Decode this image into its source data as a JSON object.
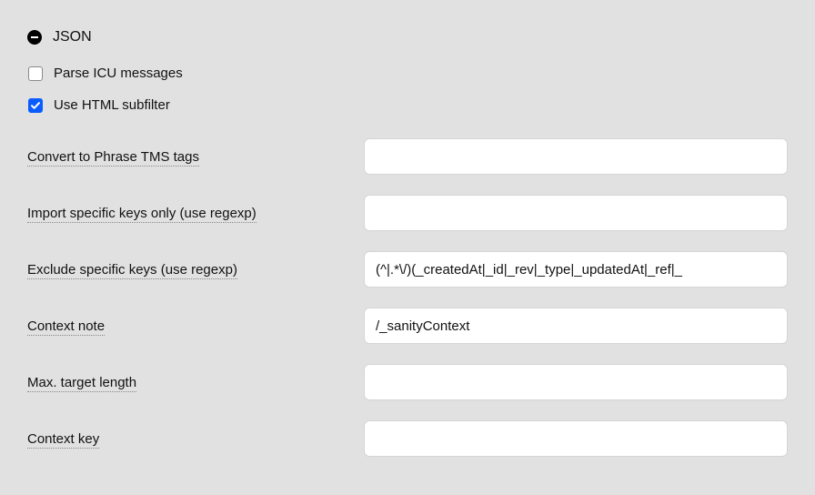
{
  "section": {
    "title": "JSON"
  },
  "checks": {
    "parse_icu": {
      "label": "Parse ICU messages",
      "checked": false
    },
    "html_subfilter": {
      "label": "Use HTML subfilter",
      "checked": true
    }
  },
  "fields": {
    "convert_tags": {
      "label": "Convert to Phrase TMS tags",
      "value": ""
    },
    "import_keys": {
      "label": "Import specific keys only (use regexp)",
      "value": ""
    },
    "exclude_keys": {
      "label": "Exclude specific keys (use regexp)",
      "value": "(^|.*\\/)(_createdAt|_id|_rev|_type|_updatedAt|_ref|_"
    },
    "context_note": {
      "label": "Context note",
      "value": "/_sanityContext"
    },
    "max_target_length": {
      "label": "Max. target length",
      "value": ""
    },
    "context_key": {
      "label": "Context key",
      "value": ""
    }
  }
}
